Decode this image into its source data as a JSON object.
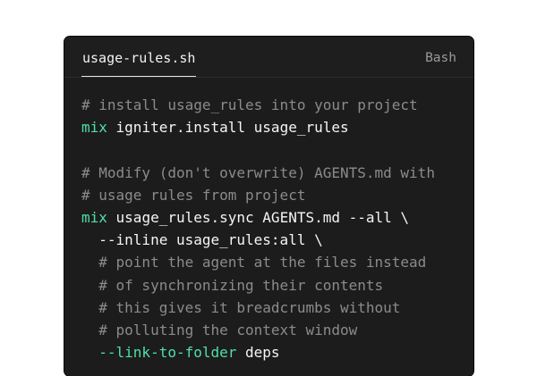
{
  "header": {
    "filename": "usage-rules.sh",
    "language": "Bash"
  },
  "code": {
    "lines": [
      [
        {
          "type": "comment",
          "text": "# install usage_rules into your project"
        }
      ],
      [
        {
          "type": "keyword",
          "text": "mix"
        },
        {
          "type": "text",
          "text": " igniter.install usage_rules"
        }
      ],
      [],
      [
        {
          "type": "comment",
          "text": "# Modify (don't overwrite) AGENTS.md with"
        }
      ],
      [
        {
          "type": "comment",
          "text": "# usage rules from project"
        }
      ],
      [
        {
          "type": "keyword",
          "text": "mix"
        },
        {
          "type": "text",
          "text": " usage_rules.sync AGENTS.md --all \\"
        }
      ],
      [
        {
          "type": "text",
          "text": "  --inline usage_rules:all \\"
        }
      ],
      [
        {
          "type": "comment",
          "text": "  # point the agent at the files instead"
        }
      ],
      [
        {
          "type": "comment",
          "text": "  # of synchronizing their contents"
        }
      ],
      [
        {
          "type": "comment",
          "text": "  # this gives it breadcrumbs without"
        }
      ],
      [
        {
          "type": "comment",
          "text": "  # polluting the context window"
        }
      ],
      [
        {
          "type": "flag",
          "text": "  --link-to-folder"
        },
        {
          "type": "text",
          "text": " deps"
        }
      ]
    ]
  },
  "colors": {
    "card_background": "#1c1c1c",
    "comment": "#8b8b8b",
    "keyword": "#4ee0a7",
    "text": "#f5f5f5"
  }
}
